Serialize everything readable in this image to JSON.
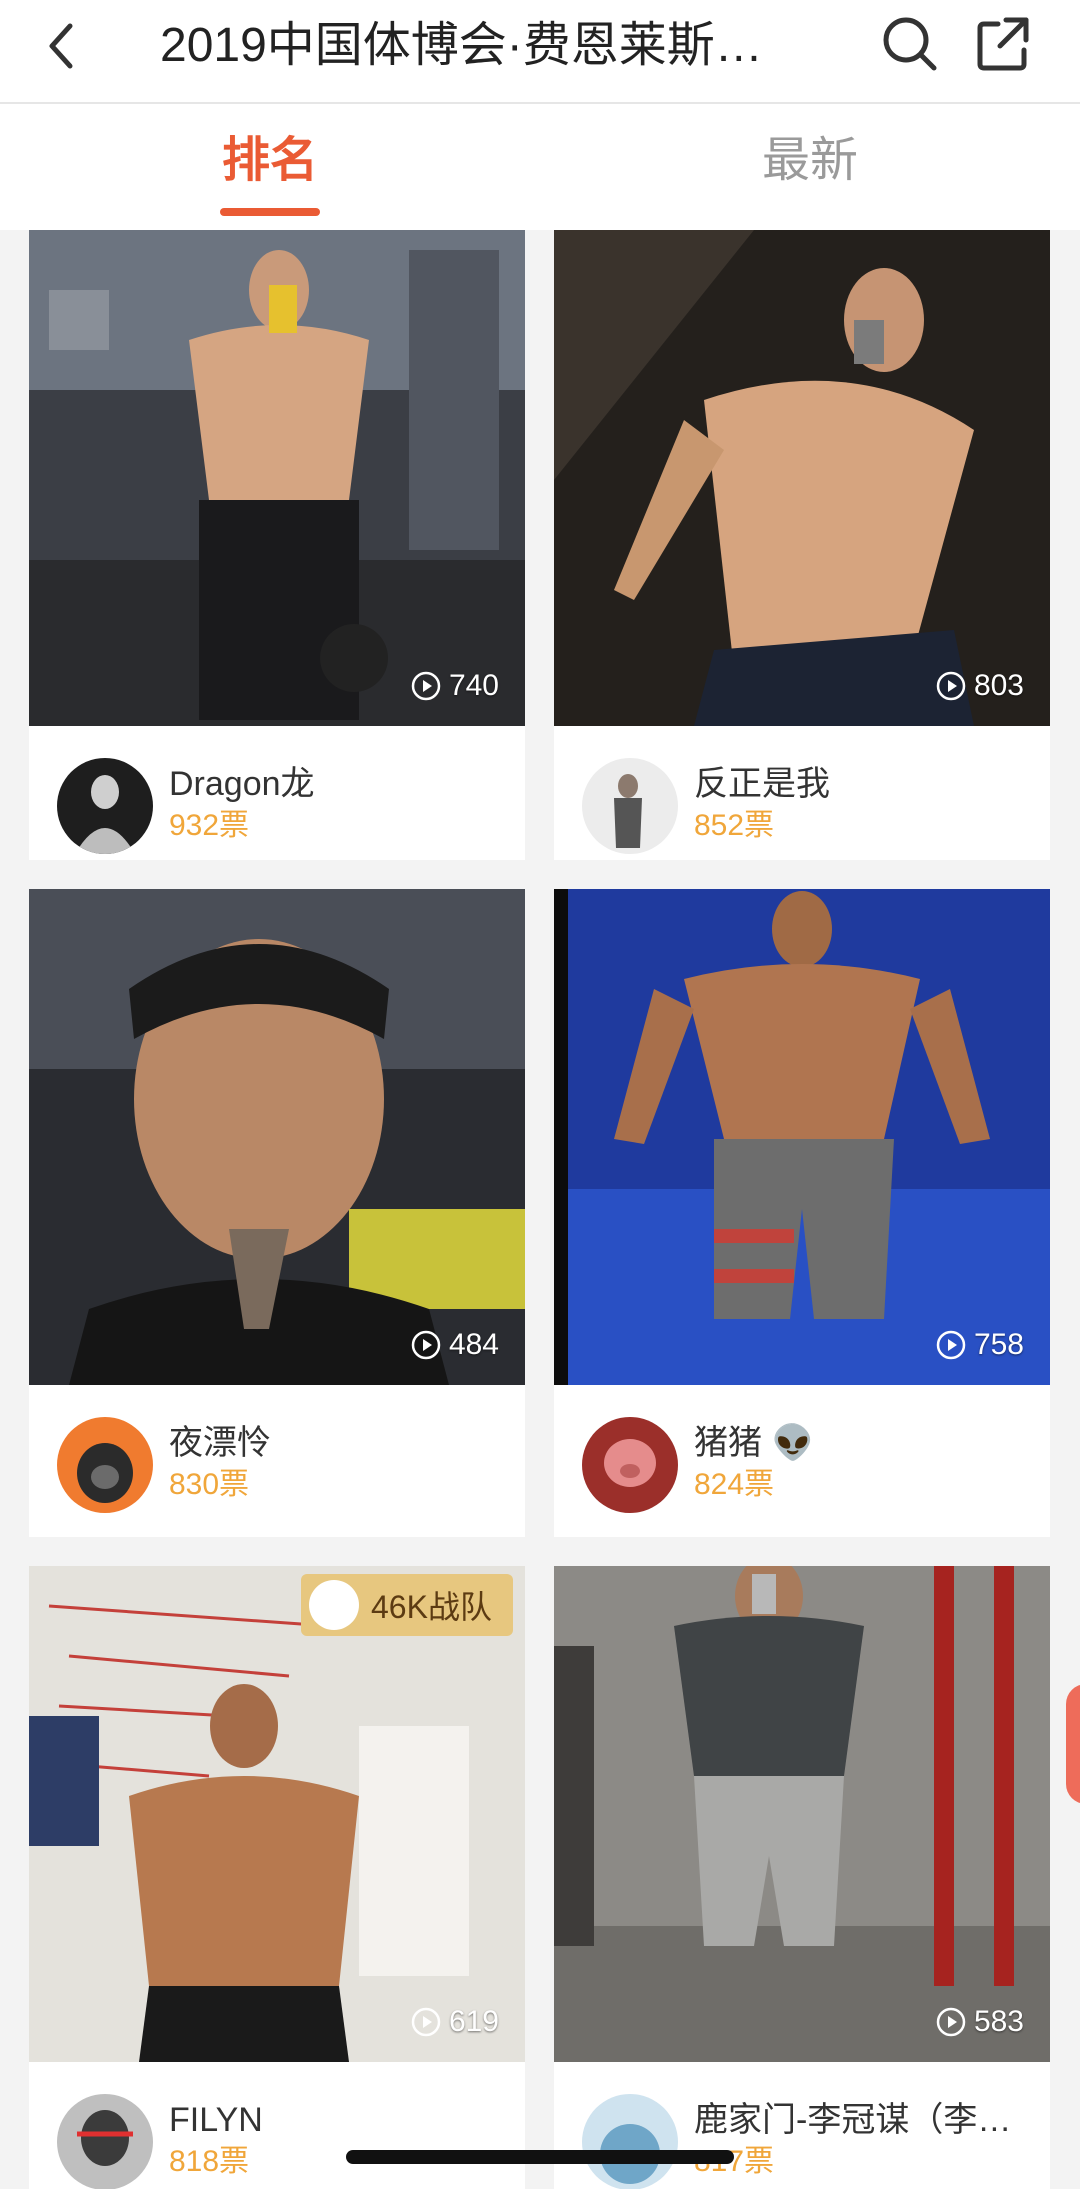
{
  "header": {
    "title": "2019中国体博会·费恩莱斯…",
    "back_icon": "chevron-left-icon",
    "search_icon": "search-icon",
    "share_icon": "share-icon"
  },
  "tabs": [
    {
      "label": "排名",
      "active": true
    },
    {
      "label": "最新",
      "active": false
    }
  ],
  "colors": {
    "accent": "#ea5b34",
    "votes": "#f0a63a",
    "team_badge": "#e7c77f"
  },
  "entries": [
    {
      "name": "Dragon龙",
      "votes": "932票",
      "views": "740"
    },
    {
      "name": "反正是我",
      "votes": "852票",
      "views": "803"
    },
    {
      "name": "夜漂怜",
      "votes": "830票",
      "views": "484"
    },
    {
      "name": "猪猪 👽",
      "votes": "824票",
      "views": "758"
    },
    {
      "name": "FILYN",
      "votes": "818票",
      "views": "619",
      "team": "46K战队"
    },
    {
      "name": "鹿家门-李冠谋（李…",
      "votes": "817票",
      "views": "583"
    }
  ]
}
